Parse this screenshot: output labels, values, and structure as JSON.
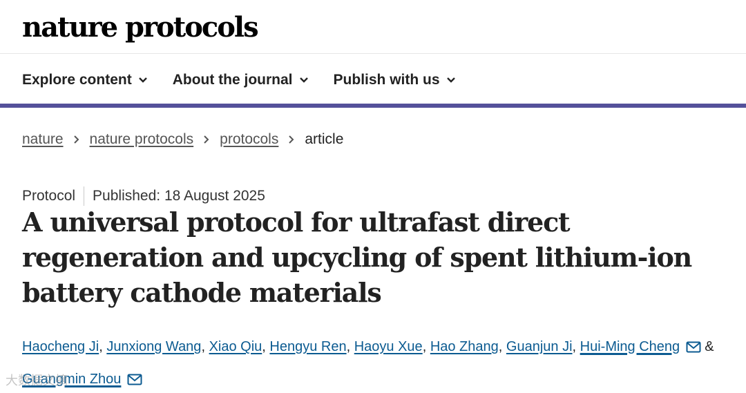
{
  "header": {
    "logo_text": "nature protocols"
  },
  "nav": {
    "items": [
      {
        "label": "Explore content"
      },
      {
        "label": "About the journal"
      },
      {
        "label": "Publish with us"
      }
    ],
    "accent_color": "#54519a"
  },
  "breadcrumb": {
    "items": [
      "nature",
      "nature protocols",
      "protocols"
    ],
    "current": "article"
  },
  "article": {
    "type": "Protocol",
    "published": "Published: 18 August 2025",
    "title": "A universal protocol for ultrafast direct regeneration and upcycling of spent lithium-ion battery cathode materials",
    "authors": [
      "Haocheng Ji",
      "Junxiong Wang",
      "Xiao Qiu",
      "Hengyu Ren",
      "Haoyu Xue",
      "Hao Zhang",
      "Guanjun Ji",
      "Hui-Ming Cheng",
      "Guangmin Zhou"
    ],
    "author_separator": ", ",
    "author_and": " & ",
    "link_color": "#0c5b91"
  },
  "watermark": {
    "text": "大数据文摘"
  }
}
